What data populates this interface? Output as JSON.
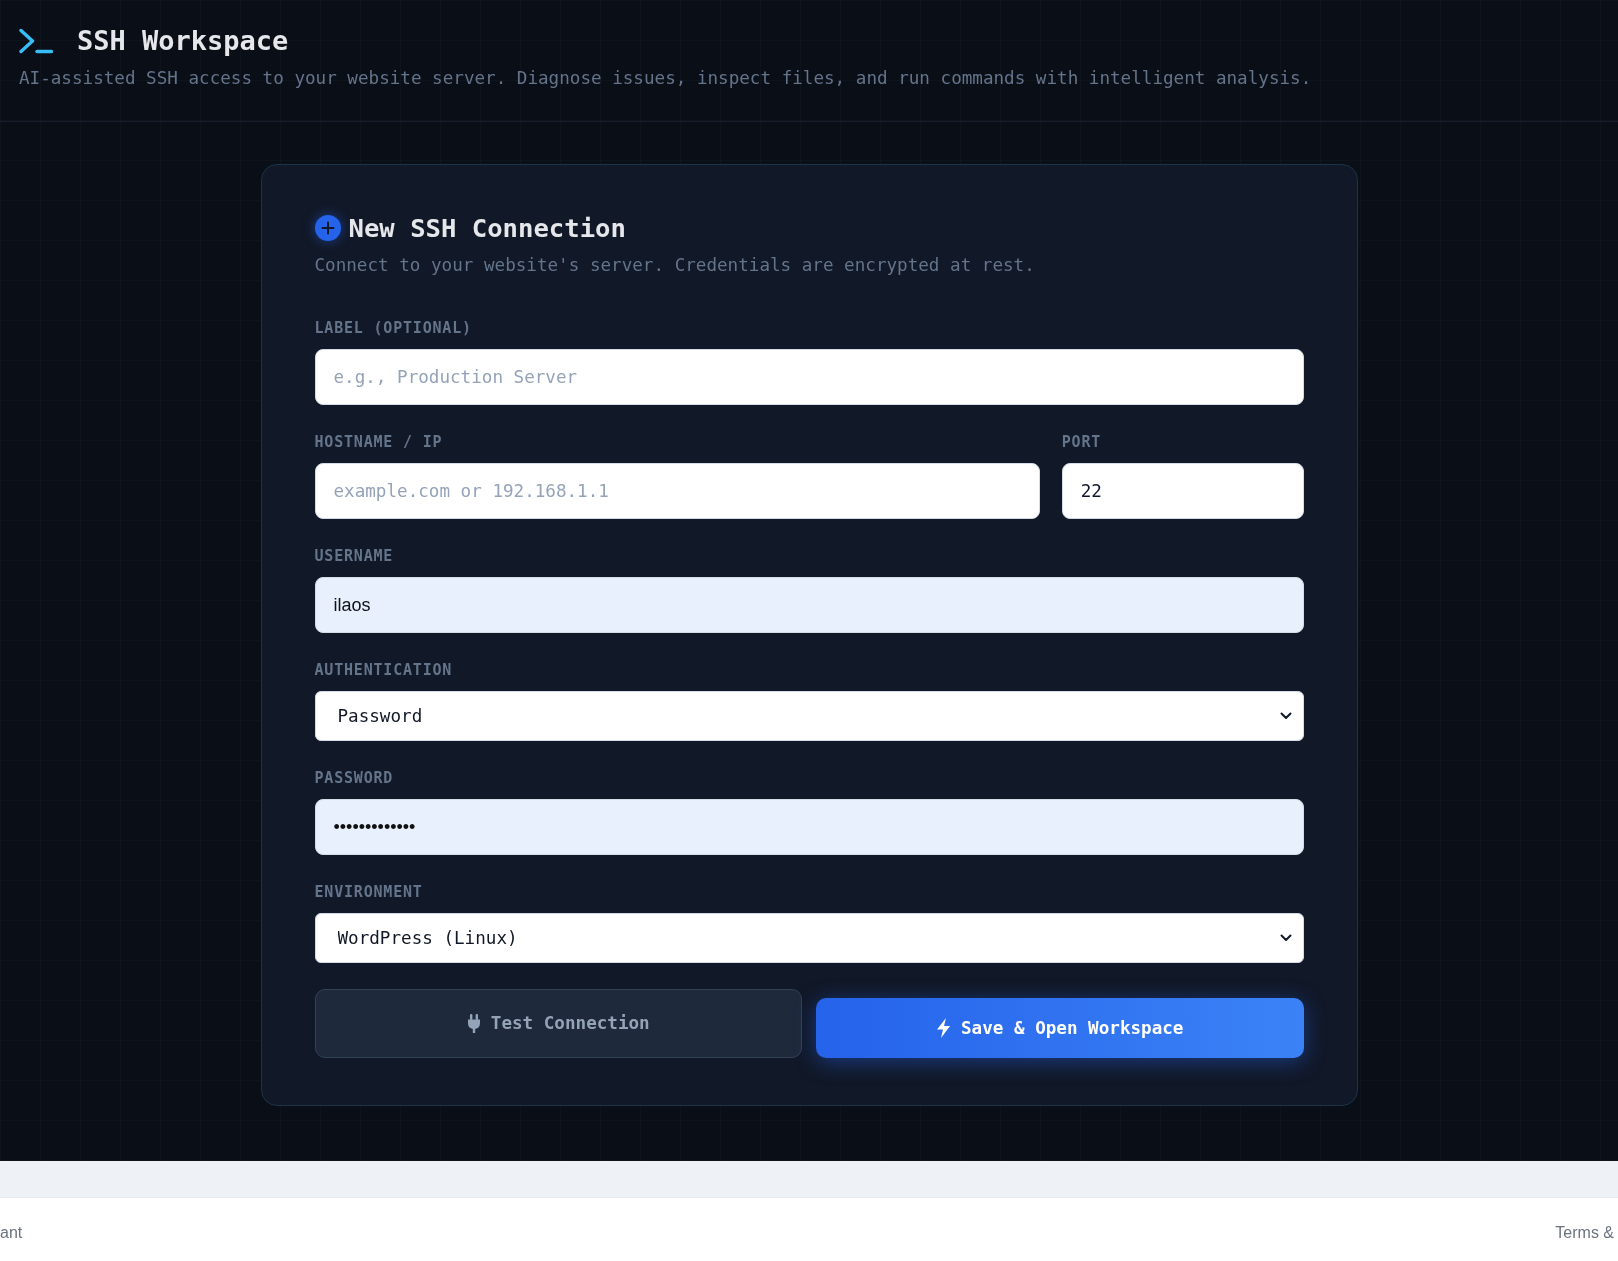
{
  "header": {
    "title": "SSH Workspace",
    "subtitle": "AI-assisted SSH access to your website server. Diagnose issues, inspect files, and run commands with intelligent analysis."
  },
  "card": {
    "title": "New SSH Connection",
    "subtitle": "Connect to your website's server. Credentials are encrypted at rest."
  },
  "form_rows": [
    {
      "fields": [
        {
          "kind": "text",
          "label": "LABEL (OPTIONAL)",
          "placeholder": "e.g., Production Server",
          "autofilled": false
        }
      ]
    },
    {
      "fields": [
        {
          "kind": "text",
          "label": "HOSTNAME / IP",
          "placeholder": "example.com or 192.168.1.1",
          "autofilled": false
        },
        {
          "kind": "text",
          "label": "PORT",
          "value": "22",
          "autofilled": false
        }
      ]
    },
    {
      "fields": [
        {
          "kind": "text",
          "label": "USERNAME",
          "value": "ilaos",
          "autofilled": true
        }
      ]
    },
    {
      "fields": [
        {
          "kind": "select",
          "label": "AUTHENTICATION",
          "value": "Password"
        }
      ]
    },
    {
      "fields": [
        {
          "kind": "text",
          "label": "PASSWORD",
          "value": "•••••••••••••",
          "autofilled": true
        }
      ]
    },
    {
      "fields": [
        {
          "kind": "select",
          "label": "ENVIRONMENT",
          "value": "WordPress (Linux)"
        }
      ]
    }
  ],
  "buttons": [
    {
      "kind": "secondary",
      "label": "Test Connection"
    },
    {
      "kind": "primary",
      "label": "Save & Open Workspace"
    }
  ],
  "footer": {
    "left_text": "ant",
    "right_text": "Terms &"
  }
}
